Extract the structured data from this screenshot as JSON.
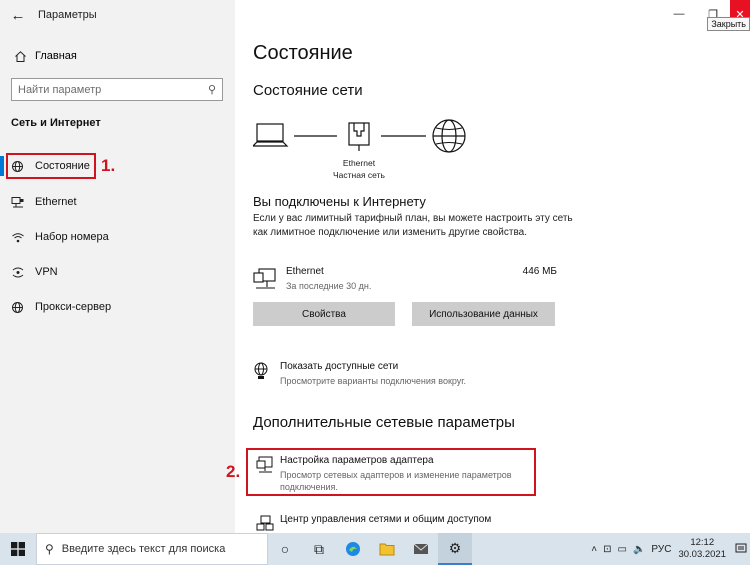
{
  "window": {
    "title": "Параметры",
    "close_tooltip": "Закрыть"
  },
  "sidebar": {
    "home_label": "Главная",
    "search_placeholder": "Найти параметр",
    "section_title": "Сеть и Интернет",
    "items": [
      {
        "label": "Состояние",
        "icon": "globe-status-icon",
        "active": true
      },
      {
        "label": "Ethernet",
        "icon": "ethernet-icon"
      },
      {
        "label": "Набор номера",
        "icon": "dialup-icon"
      },
      {
        "label": "VPN",
        "icon": "vpn-icon"
      },
      {
        "label": "Прокси-сервер",
        "icon": "globe-icon"
      }
    ]
  },
  "annotations": {
    "marker1": "1.",
    "marker2": "2.",
    "highlight_color": "#d0141f"
  },
  "main": {
    "page_title": "Состояние",
    "network_status_heading": "Состояние сети",
    "diagram": {
      "adapter_name": "Ethernet",
      "network_type": "Частная сеть"
    },
    "connected_title": "Вы подключены к Интернету",
    "connected_desc": "Если у вас лимитный тарифный план, вы можете настроить эту сеть как лимитное подключение или изменить другие свойства.",
    "adapter": {
      "name": "Ethernet",
      "period": "За последние 30 дн.",
      "usage": "446 МБ"
    },
    "buttons": {
      "properties": "Свойства",
      "data_usage": "Использование данных"
    },
    "show_networks": {
      "title": "Показать доступные сети",
      "subtitle": "Просмотрите варианты подключения вокруг."
    },
    "advanced_heading": "Дополнительные сетевые параметры",
    "adapter_settings": {
      "title": "Настройка параметров адаптера",
      "subtitle": "Просмотр сетевых адаптеров и изменение параметров подключения."
    },
    "sharing_center": {
      "title": "Центр управления сетями и общим доступом"
    }
  },
  "taskbar": {
    "search_placeholder": "Введите здесь текст для поиска",
    "language": "РУС",
    "time": "12:12",
    "date": "30.03.2021",
    "accent": "#0078d7"
  }
}
